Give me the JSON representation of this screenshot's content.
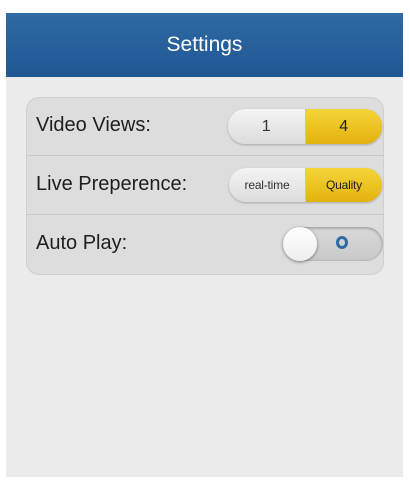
{
  "header": {
    "title": "Settings"
  },
  "settings": {
    "video_views": {
      "label": "Video Views:",
      "options": [
        "1",
        "4"
      ],
      "selected": "4"
    },
    "live_preference": {
      "label": "Live Preperence:",
      "options": [
        "real-time",
        "Quality"
      ],
      "selected": "Quality"
    },
    "auto_play": {
      "label": "Auto Play:",
      "state": "off"
    }
  },
  "colors": {
    "header_bg": "#1f5793",
    "selected_segment": "#f1c92a",
    "panel_bg": "#dddddd",
    "screen_bg": "#ebebeb"
  }
}
